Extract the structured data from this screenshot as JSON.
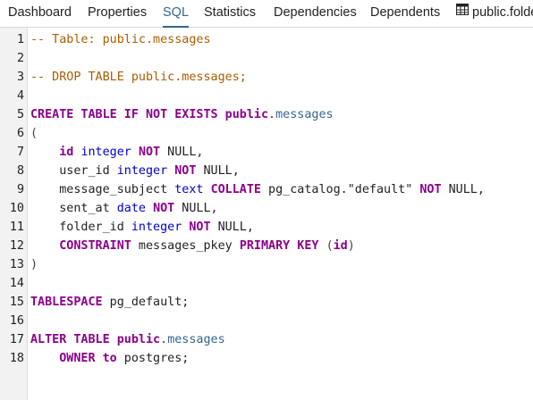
{
  "tabs": [
    {
      "label": "Dashboard",
      "active": false
    },
    {
      "label": "Properties",
      "active": false
    },
    {
      "label": "SQL",
      "active": true
    },
    {
      "label": "Statistics",
      "active": false
    },
    {
      "label": "Dependencies",
      "active": false
    },
    {
      "label": "Dependents",
      "active": false
    },
    {
      "label": "public.folde",
      "active": false,
      "icon": "table-icon"
    }
  ],
  "colors": {
    "accent": "#326690",
    "keyword": "#8b008b",
    "type": "#0000cd",
    "comment": "#aa5d00",
    "gutter_bg": "#f2f2f2"
  },
  "editor": {
    "lines": [
      {
        "n": "1",
        "tokens": [
          [
            "cm",
            "-- Table: public.messages"
          ]
        ]
      },
      {
        "n": "2",
        "tokens": []
      },
      {
        "n": "3",
        "tokens": [
          [
            "cm",
            "-- DROP TABLE public.messages;"
          ]
        ]
      },
      {
        "n": "4",
        "tokens": []
      },
      {
        "n": "5",
        "tokens": [
          [
            "kw",
            "CREATE TABLE IF NOT EXISTS public"
          ],
          [
            "p",
            "."
          ],
          [
            "dt",
            "messages"
          ]
        ]
      },
      {
        "n": "6",
        "tokens": [
          [
            "p",
            "("
          ]
        ]
      },
      {
        "n": "7",
        "tokens": [
          [
            "id",
            "    "
          ],
          [
            "kw",
            "id"
          ],
          [
            "id",
            " "
          ],
          [
            "ty",
            "integer"
          ],
          [
            "id",
            " "
          ],
          [
            "kw",
            "NOT"
          ],
          [
            "id",
            " NULL,"
          ]
        ]
      },
      {
        "n": "8",
        "tokens": [
          [
            "id",
            "    user_id "
          ],
          [
            "ty",
            "integer"
          ],
          [
            "id",
            " "
          ],
          [
            "kw",
            "NOT"
          ],
          [
            "id",
            " NULL,"
          ]
        ]
      },
      {
        "n": "9",
        "tokens": [
          [
            "id",
            "    message_subject "
          ],
          [
            "ty",
            "text"
          ],
          [
            "id",
            " "
          ],
          [
            "kw",
            "COLLATE"
          ],
          [
            "id",
            " pg_catalog."
          ],
          [
            "st",
            "\"default\""
          ],
          [
            "id",
            " "
          ],
          [
            "kw",
            "NOT"
          ],
          [
            "id",
            " NULL,"
          ]
        ]
      },
      {
        "n": "10",
        "tokens": [
          [
            "id",
            "    sent_at "
          ],
          [
            "ty",
            "date"
          ],
          [
            "id",
            " "
          ],
          [
            "kw",
            "NOT"
          ],
          [
            "id",
            " NULL,"
          ]
        ]
      },
      {
        "n": "11",
        "tokens": [
          [
            "id",
            "    folder_id "
          ],
          [
            "ty",
            "integer"
          ],
          [
            "id",
            " "
          ],
          [
            "kw",
            "NOT"
          ],
          [
            "id",
            " NULL,"
          ]
        ]
      },
      {
        "n": "12",
        "tokens": [
          [
            "id",
            "    "
          ],
          [
            "kw",
            "CONSTRAINT"
          ],
          [
            "id",
            " messages_pkey "
          ],
          [
            "kw",
            "PRIMARY KEY"
          ],
          [
            "id",
            " "
          ],
          [
            "p",
            "("
          ],
          [
            "kw",
            "id"
          ],
          [
            "p",
            ")"
          ]
        ]
      },
      {
        "n": "13",
        "tokens": [
          [
            "p",
            ")"
          ]
        ]
      },
      {
        "n": "14",
        "tokens": []
      },
      {
        "n": "15",
        "tokens": [
          [
            "kw",
            "TABLESPACE"
          ],
          [
            "id",
            " pg_default;"
          ]
        ]
      },
      {
        "n": "16",
        "tokens": []
      },
      {
        "n": "17",
        "tokens": [
          [
            "kw",
            "ALTER TABLE public"
          ],
          [
            "p",
            "."
          ],
          [
            "dt",
            "messages"
          ]
        ]
      },
      {
        "n": "18",
        "tokens": [
          [
            "id",
            "    "
          ],
          [
            "kw",
            "OWNER"
          ],
          [
            "id",
            " "
          ],
          [
            "kw",
            "to"
          ],
          [
            "id",
            " postgres;"
          ]
        ]
      }
    ]
  }
}
